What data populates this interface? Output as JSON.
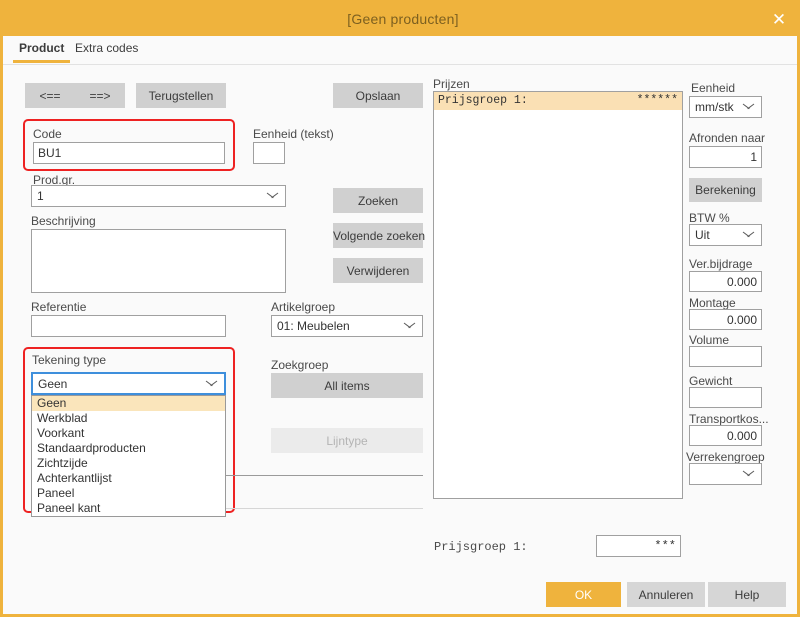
{
  "window": {
    "title": "[Geen producten]",
    "close_icon": "close-icon"
  },
  "tabs": [
    {
      "label": "Product",
      "active": true
    },
    {
      "label": "Extra codes",
      "active": false
    }
  ],
  "toolbar": {
    "prev_label": "<==",
    "next_label": "==>",
    "reset_label": "Terugstellen",
    "save_label": "Opslaan"
  },
  "left_form": {
    "code_label": "Code",
    "code_value": "BU1",
    "unit_text_label": "Eenheid (tekst)",
    "unit_text_value": "",
    "prodgr_label": "Prod.gr.",
    "prodgr_value": "1",
    "description_label": "Beschrijving",
    "description_value": "",
    "reference_label": "Referentie",
    "reference_value": "",
    "drawing_type_label": "Tekening type",
    "drawing_type_value": "Geen",
    "drawing_type_options": [
      "Geen",
      "Werkblad",
      "Voorkant",
      "Standaardproducten",
      "Zichtzijde",
      "Achterkantlijst",
      "Paneel",
      "Paneel kant"
    ],
    "drawing_type_selected_index": 0
  },
  "middle": {
    "search_label": "Zoeken",
    "search_next_label": "Volgende zoeken",
    "delete_label": "Verwijderen",
    "article_group_label": "Artikelgroep",
    "article_group_value": "01: Meubelen",
    "search_group_label": "Zoekgroep",
    "all_items_label": "All items",
    "line_type_label": "Lijntype"
  },
  "prices": {
    "header_label": "Prijzen",
    "rows": [
      {
        "name": "Prijsgroep  1:",
        "value": "******",
        "selected": true
      }
    ]
  },
  "right_panel": {
    "unit_label": "Eenheid",
    "unit_value": "mm/stk",
    "round_to_label": "Afronden naar",
    "round_to_value": "1",
    "calculation_label": "Berekening",
    "vat_label": "BTW %",
    "vat_value": "Uit",
    "contribution_label": "Ver.bijdrage",
    "contribution_value": "0.000",
    "assembly_label": "Montage",
    "assembly_value": "0.000",
    "volume_label": "Volume",
    "volume_value": "",
    "weight_label": "Gewicht",
    "weight_value": "",
    "transport_label": "Transportkos...",
    "transport_value": "0.000",
    "settlement_group_label": "Verrekengroep",
    "settlement_group_value": ""
  },
  "bottom": {
    "price_group_label": "Prijsgroep  1:",
    "price_group_value": "***",
    "ok_label": "OK",
    "cancel_label": "Annuleren",
    "help_label": "Help"
  },
  "colors": {
    "accent": "#efb33d",
    "highlight": "#ee2222",
    "selection": "#fae0b4",
    "focus": "#3e8fdc"
  }
}
